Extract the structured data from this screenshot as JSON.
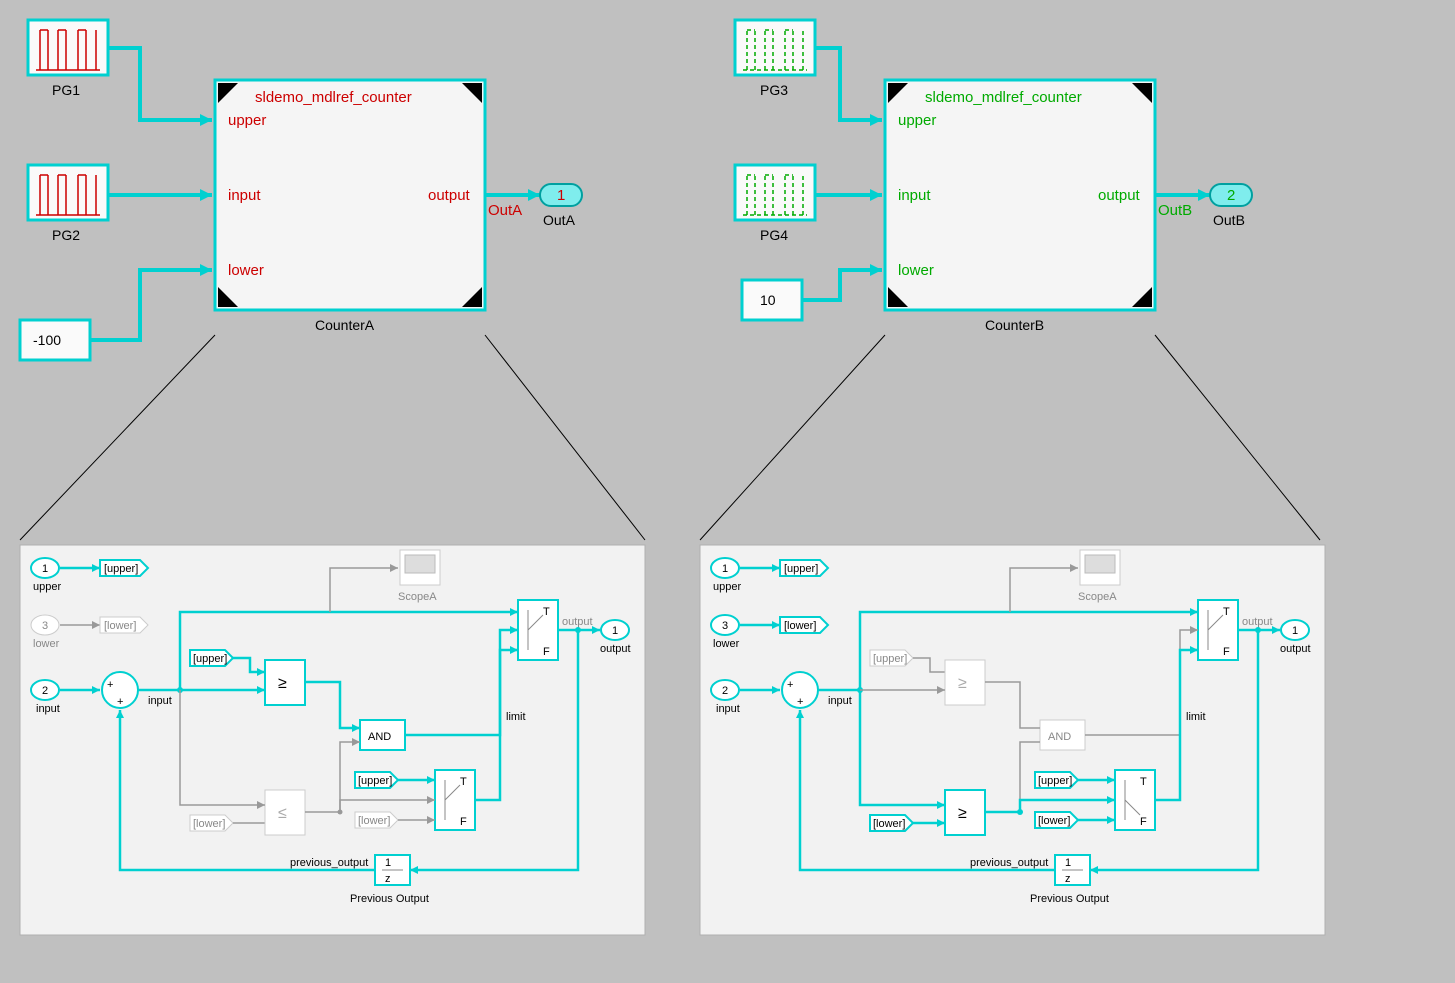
{
  "left": {
    "modelRefTitle": "sldemo_mdlref_counter",
    "ports": {
      "upper": "upper",
      "input": "input",
      "lower": "lower",
      "output": "output"
    },
    "blockLabel": "CounterA",
    "sources": {
      "pg1": "PG1",
      "pg2": "PG2",
      "constVal": "-100"
    },
    "out": {
      "signal": "OutA",
      "portNum": "1",
      "portLabel": "OutA"
    }
  },
  "right": {
    "modelRefTitle": "sldemo_mdlref_counter",
    "ports": {
      "upper": "upper",
      "input": "input",
      "lower": "lower",
      "output": "output"
    },
    "blockLabel": "CounterB",
    "sources": {
      "pg3": "PG3",
      "pg4": "PG4",
      "constVal": "10"
    },
    "out": {
      "signal": "OutB",
      "portNum": "2",
      "portLabel": "OutB"
    }
  },
  "sub": {
    "inports": {
      "p1": "1",
      "p1Label": "upper",
      "p2": "2",
      "p2Label": "input",
      "p3": "3",
      "p3Label": "lower"
    },
    "outport": {
      "num": "1",
      "label": "output"
    },
    "tags": {
      "upper": "[upper]",
      "lower": "[lower]"
    },
    "scope": "ScopeA",
    "and": "AND",
    "switchT": "T",
    "switchF": "F",
    "limit": "limit",
    "prevSig": "previous_output",
    "prevBlock": "Previous Output",
    "inputSig": "input",
    "outputSig": "output",
    "zinv": "1\nz",
    "ge": "≥"
  }
}
